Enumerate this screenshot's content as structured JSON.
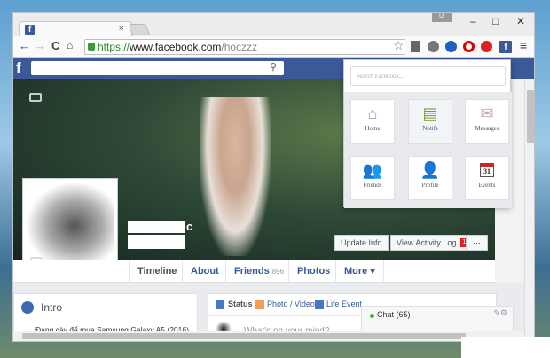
{
  "browser": {
    "user_badge": "Ư",
    "url_scheme": "https://",
    "url_host": "www.facebook.com",
    "url_path": "/hoczzz",
    "tab_close": "×",
    "window_controls": [
      "–",
      "□",
      "✕"
    ]
  },
  "fb": {
    "logo": "f",
    "search_icon": "search-icon"
  },
  "cover": {
    "name_suffix": "c",
    "update_info": "Update Info",
    "activity_log": "View Activity Log",
    "activity_badge": "1",
    "more_dots": "···"
  },
  "nav": {
    "tabs": [
      {
        "label": "Timeline"
      },
      {
        "label": "About"
      },
      {
        "label": "Friends",
        "count": "896"
      },
      {
        "label": "Photos"
      },
      {
        "label": "More ▾"
      }
    ]
  },
  "intro": {
    "title": "Intro",
    "text": "Đang cày để mua Samsung Galaxy A5 (2016)"
  },
  "composer": {
    "status": "Status",
    "photo": "Photo / Video",
    "life": "Life Event",
    "placeholder": "What's on your mind?"
  },
  "chat": {
    "label": "Chat (65)"
  },
  "popup": {
    "search_placeholder": "Search Facebook...",
    "items": [
      {
        "label": "Home",
        "icon": "home-icon"
      },
      {
        "label": "Notifs",
        "icon": "notifications-icon"
      },
      {
        "label": "Messages",
        "icon": "messages-icon"
      },
      {
        "label": "Friends",
        "icon": "friends-icon"
      },
      {
        "label": "Profile",
        "icon": "profile-icon"
      },
      {
        "label": "Events",
        "icon": "calendar-icon",
        "day": "31"
      }
    ]
  },
  "colors": {
    "fb_blue": "#3b5998",
    "link": "#365899",
    "badge": "#e02020"
  }
}
